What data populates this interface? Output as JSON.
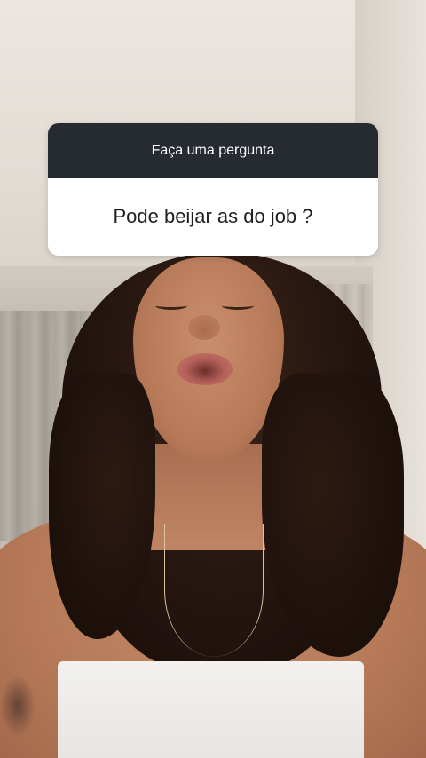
{
  "sticker": {
    "header": "Faça uma pergunta",
    "question": "Pode beijar as do job ?",
    "header_bg": "#262b31",
    "body_bg": "#ffffff"
  }
}
